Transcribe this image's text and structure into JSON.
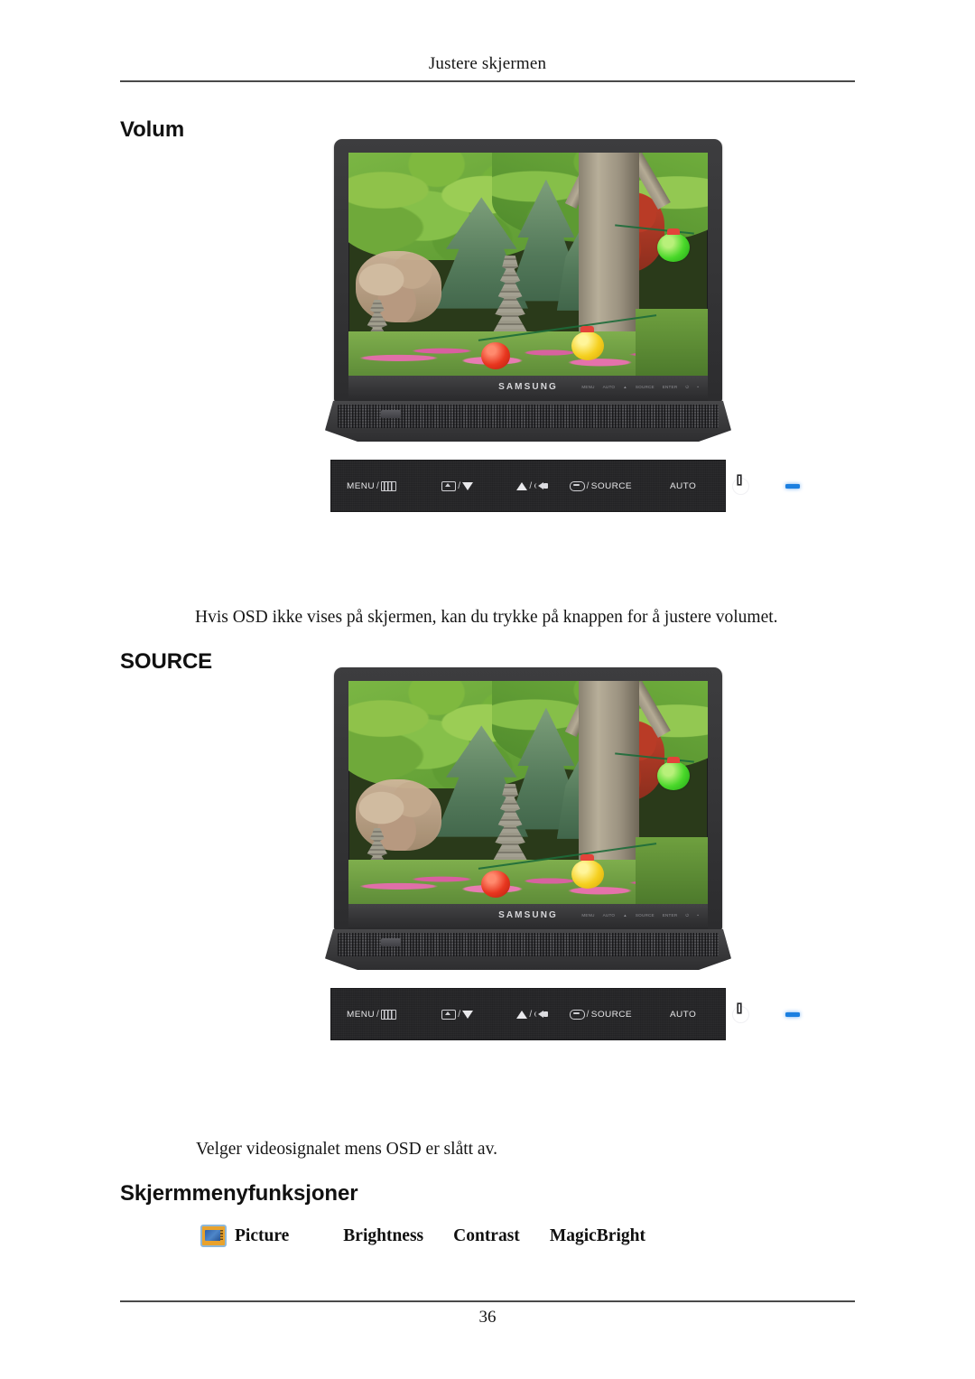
{
  "document": {
    "running_header": "Justere skjermen",
    "page_number": "36"
  },
  "sections": {
    "volume": {
      "heading": "Volum",
      "caption": "Hvis OSD ikke vises på skjermen, kan du trykke på knappen for å justere volumet."
    },
    "source": {
      "heading": "SOURCE",
      "caption": "Velger videosignalet mens OSD er slått av."
    },
    "osd_functions": {
      "heading": "Skjermmenyfunksjoner",
      "items": [
        {
          "label": "Picture",
          "icon": "picture-icon"
        },
        {
          "label": "Brightness"
        },
        {
          "label": "Contrast"
        },
        {
          "label": "MagicBright"
        }
      ]
    }
  },
  "monitor": {
    "brand_logo": "SAMSUNG",
    "bezel_button_labels": [
      "MENU",
      "AUTO",
      "▲",
      "SOURCE",
      "ENTER",
      "⏻",
      "•"
    ],
    "screen_image_alt": "Korean garden with stone pagodas, trees and paper lanterns"
  },
  "control_panel": {
    "buttons": [
      {
        "name": "menu-button",
        "label": "MENU",
        "separator": "/",
        "icon": "osd-grid-icon"
      },
      {
        "name": "enter-down-button",
        "label": "",
        "separator": "/",
        "icon": "enter-icon",
        "icon2": "down-arrow-icon"
      },
      {
        "name": "up-volume-button",
        "label": "",
        "separator": "/",
        "icon": "up-arrow-icon",
        "icon2": "speaker-icon"
      },
      {
        "name": "enter-source-button",
        "label": "SOURCE",
        "separator": "/",
        "icon": "enter-round-icon"
      },
      {
        "name": "auto-button",
        "label": "AUTO"
      },
      {
        "name": "power-button",
        "label": "",
        "icon": "power-icon"
      },
      {
        "name": "power-led",
        "label": "",
        "icon": "led-indicator"
      }
    ]
  },
  "colors": {
    "led_blue": "#1b7fe0",
    "panel_dark": "#252527",
    "rule_gray": "#4a4a4a",
    "icon_orange": "#e9a22c",
    "icon_border_blue": "#8fb8d8"
  }
}
